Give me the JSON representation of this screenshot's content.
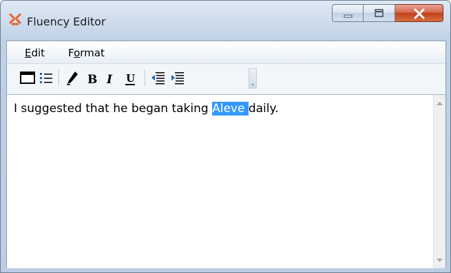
{
  "window": {
    "title": "Fluency Editor",
    "icon": "fluency-app-icon"
  },
  "caption_buttons": [
    "minimize-icon",
    "maximize-icon",
    "close-icon"
  ],
  "menu": {
    "items": [
      {
        "label": "Edit",
        "underline": "E",
        "rest": "dit"
      },
      {
        "label": "Format",
        "underline_prefix": "F",
        "underline": "o",
        "rest": "rmat"
      }
    ]
  },
  "toolbar": {
    "buttons": [
      {
        "name": "window-icon"
      },
      {
        "name": "bullet-list-icon"
      },
      {
        "name": "pen-icon"
      },
      {
        "name": "bold-button",
        "glyph": "B"
      },
      {
        "name": "italic-button",
        "glyph": "I"
      },
      {
        "name": "underline-button",
        "glyph": "U"
      },
      {
        "name": "decrease-indent-icon"
      },
      {
        "name": "increase-indent-icon"
      }
    ]
  },
  "editor": {
    "text_before": "I suggested that he began taking ",
    "selected": "Aleve ",
    "text_after": "daily."
  },
  "colors": {
    "selection": "#3399ff",
    "app_icon": "#e8622c",
    "close_button": "#c2401f"
  }
}
